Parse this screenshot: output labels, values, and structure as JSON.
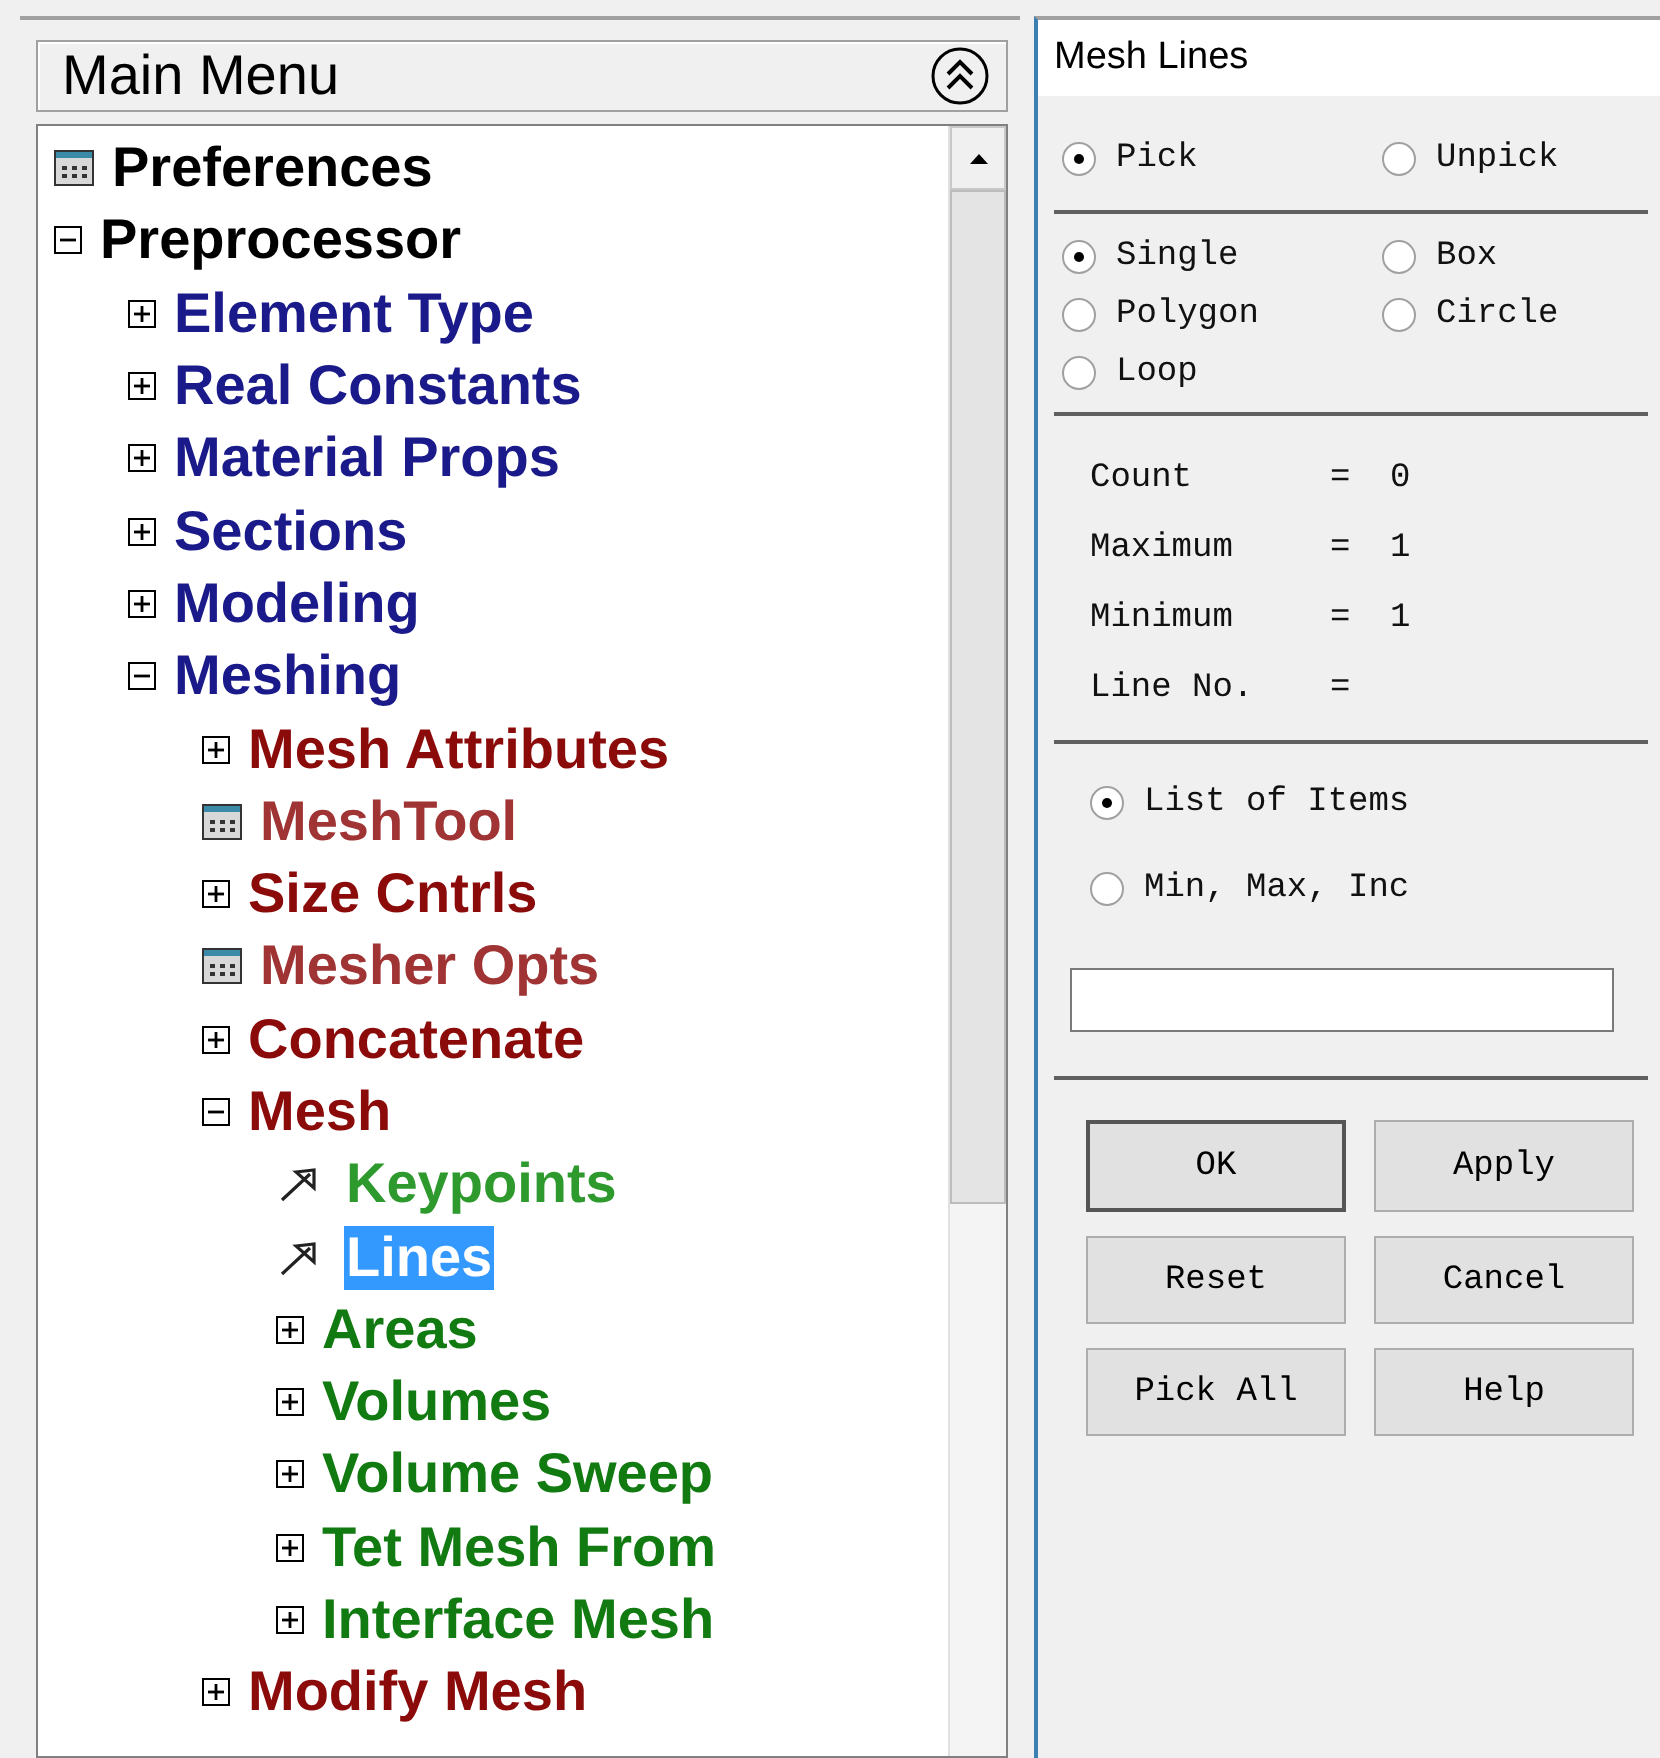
{
  "main_menu": {
    "title": "Main Menu",
    "tree": [
      {
        "label": "Preferences",
        "kind": "dialog",
        "selected": false
      },
      {
        "label": "Preprocessor",
        "kind": "folder",
        "expanded": true,
        "selected": false,
        "children": [
          {
            "label": "Element Type",
            "kind": "folder",
            "expanded": false,
            "selected": false
          },
          {
            "label": "Real Constants",
            "kind": "folder",
            "expanded": false,
            "selected": false
          },
          {
            "label": "Material Props",
            "kind": "folder",
            "expanded": false,
            "selected": false
          },
          {
            "label": "Sections",
            "kind": "folder",
            "expanded": false,
            "selected": false
          },
          {
            "label": "Modeling",
            "kind": "folder",
            "expanded": false,
            "selected": false
          },
          {
            "label": "Meshing",
            "kind": "folder",
            "expanded": true,
            "selected": false,
            "children": [
              {
                "label": "Mesh Attributes",
                "kind": "folder",
                "expanded": false,
                "selected": false
              },
              {
                "label": "MeshTool",
                "kind": "dialog",
                "selected": false
              },
              {
                "label": "Size Cntrls",
                "kind": "folder",
                "expanded": false,
                "selected": false
              },
              {
                "label": "Mesher Opts",
                "kind": "dialog",
                "selected": false
              },
              {
                "label": "Concatenate",
                "kind": "folder",
                "expanded": false,
                "selected": false
              },
              {
                "label": "Mesh",
                "kind": "folder",
                "expanded": true,
                "selected": false,
                "children": [
                  {
                    "label": "Keypoints",
                    "kind": "pick",
                    "selected": false
                  },
                  {
                    "label": "Lines",
                    "kind": "pick",
                    "selected": true
                  },
                  {
                    "label": "Areas",
                    "kind": "folder",
                    "expanded": false,
                    "selected": false
                  },
                  {
                    "label": "Volumes",
                    "kind": "folder",
                    "expanded": false,
                    "selected": false
                  },
                  {
                    "label": "Volume Sweep",
                    "kind": "folder",
                    "expanded": false,
                    "selected": false
                  },
                  {
                    "label": "Tet Mesh From",
                    "kind": "folder",
                    "expanded": false,
                    "selected": false
                  },
                  {
                    "label": "Interface Mesh",
                    "kind": "folder",
                    "expanded": false,
                    "selected": false
                  }
                ]
              },
              {
                "label": "Modify Mesh",
                "kind": "folder",
                "expanded": false,
                "selected": false
              }
            ]
          }
        ]
      }
    ]
  },
  "dialog": {
    "title": "Mesh Lines",
    "pick_mode": [
      {
        "label": "Pick",
        "selected": true
      },
      {
        "label": "Unpick",
        "selected": false
      }
    ],
    "pick_shape": [
      {
        "label": "Single",
        "selected": true
      },
      {
        "label": "Box",
        "selected": false
      },
      {
        "label": "Polygon",
        "selected": false
      },
      {
        "label": "Circle",
        "selected": false
      },
      {
        "label": "Loop",
        "selected": false
      }
    ],
    "stats": [
      {
        "label": "Count",
        "sign": "=",
        "value": "0"
      },
      {
        "label": "Maximum",
        "sign": "=",
        "value": "1"
      },
      {
        "label": "Minimum",
        "sign": "=",
        "value": "1"
      },
      {
        "label": "Line No.",
        "sign": "="
      }
    ],
    "entry_mode": [
      {
        "label": "List of Items",
        "selected": true
      },
      {
        "label": "Min, Max, Inc",
        "selected": false
      }
    ],
    "buttons": [
      {
        "label": "OK",
        "default": true
      },
      {
        "label": "Apply",
        "default": false
      },
      {
        "label": "Reset",
        "default": false
      },
      {
        "label": "Cancel",
        "default": false
      },
      {
        "label": "Pick All",
        "default": false
      },
      {
        "label": "Help",
        "default": false
      }
    ]
  }
}
